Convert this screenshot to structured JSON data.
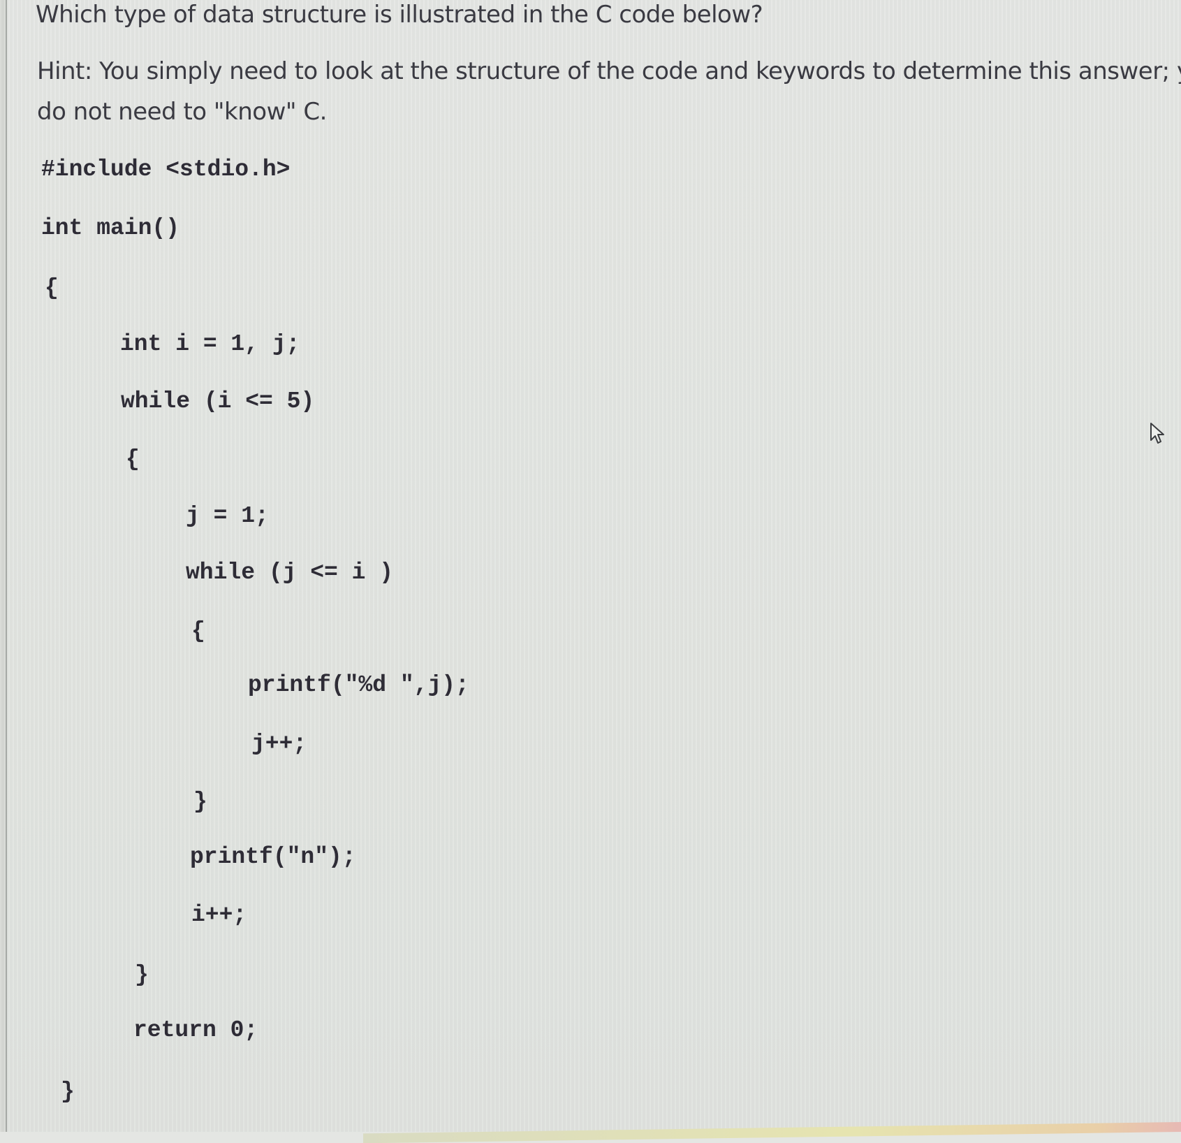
{
  "question": {
    "title": "Which type of data structure is illustrated in the C code below?",
    "hint_line_1": "Hint: You simply need to look at the structure of the code and keywords to determine this answer; you",
    "hint_line_2": "do not need to \"know\" C."
  },
  "code": {
    "lines": [
      "#include <stdio.h>",
      "int main()",
      "{",
      "int i = 1, j;",
      "while (i <= 5)",
      "{",
      "j = 1;",
      "while (j <= i )",
      "{",
      "printf(\"%d \",j);",
      "j++;",
      "}",
      "printf(\"n\");",
      "i++;",
      "}",
      "return 0;",
      "}"
    ]
  },
  "icons": {
    "cursor": "mouse-pointer-icon"
  }
}
